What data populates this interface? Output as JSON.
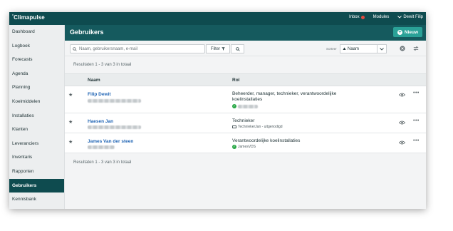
{
  "topbar": {
    "brand": "Climapulse",
    "inbox_label": "Inbox",
    "modules_label": "Modules",
    "user_label": "Dewit Filip"
  },
  "sidebar": {
    "items": [
      {
        "label": "Dashboard"
      },
      {
        "label": "Logboek"
      },
      {
        "label": "Forecasts"
      },
      {
        "label": "Agenda"
      },
      {
        "label": "Planning"
      },
      {
        "label": "Koelmiddelen"
      },
      {
        "label": "Installaties"
      },
      {
        "label": "Klanten"
      },
      {
        "label": "Leveranciers"
      },
      {
        "label": "Inventaris"
      },
      {
        "label": "Rapporten"
      },
      {
        "label": "Gebruikers"
      },
      {
        "label": "Kennisbank"
      }
    ],
    "active": "Gebruikers"
  },
  "header": {
    "title": "Gebruikers",
    "new_button": "Nieuw"
  },
  "toolbar": {
    "search_placeholder": "Naam, gebruikersnaam, e-mail",
    "filter_label": "Filter",
    "sort_label": "Sorteer",
    "sort_value": "Naam"
  },
  "results_text": "Resultaten 1 - 3 van 3 in totaal",
  "table": {
    "columns": {
      "name": "Naam",
      "role": "Rol"
    },
    "rows": [
      {
        "name": "Filip Dewit",
        "role": "Beheerder, manager, technieker, verantwoordelijke koelinstallaties",
        "status_icon": "check-icon"
      },
      {
        "name": "Haesen Jan",
        "role": "Technieker",
        "username": "TechniekerJan - uitgenodigd",
        "status_icon": "mail-icon"
      },
      {
        "name": "James Van der steen",
        "role": "Verantwoordelijke koelinstallaties",
        "username": "JamesVDS",
        "status_icon": "check-icon"
      }
    ]
  },
  "colors": {
    "topbar": "#0e4b4f",
    "header": "#155a5e",
    "new_button": "#2aa197",
    "link": "#1f64b4",
    "active_nav": "#0e4b4f"
  }
}
